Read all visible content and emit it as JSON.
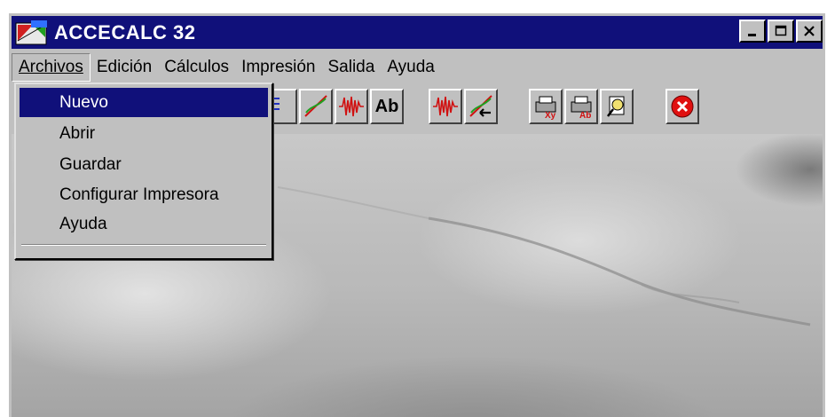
{
  "window": {
    "title": "ACCECALC 32"
  },
  "menubar": {
    "items": [
      {
        "label": "Archivos"
      },
      {
        "label": "Edición"
      },
      {
        "label": "Cálculos"
      },
      {
        "label": "Impresión"
      },
      {
        "label": "Salida"
      },
      {
        "label": "Ayuda"
      }
    ]
  },
  "dropdown": {
    "items": [
      {
        "label": "Nuevo"
      },
      {
        "label": "Abrir"
      },
      {
        "label": "Guardar"
      },
      {
        "label": "Configurar Impresora"
      },
      {
        "label": "Ayuda"
      }
    ]
  },
  "toolbar": {
    "buttons": [
      {
        "icon": "graph-axes-icon"
      },
      {
        "icon": "line-graph-icon"
      },
      {
        "icon": "waveform-icon"
      },
      {
        "label": "Ab"
      },
      {
        "icon": "waveform-icon"
      },
      {
        "icon": "graph-import-icon"
      },
      {
        "icon": "print-xy-icon"
      },
      {
        "icon": "print-ab-icon"
      },
      {
        "icon": "print-preview-icon"
      },
      {
        "icon": "exit-icon"
      }
    ]
  },
  "colors": {
    "titlebar": "#10107a",
    "highlight": "#10107a",
    "face": "#c0c0c0",
    "exit": "#e01010",
    "waveform": "#d01010"
  }
}
